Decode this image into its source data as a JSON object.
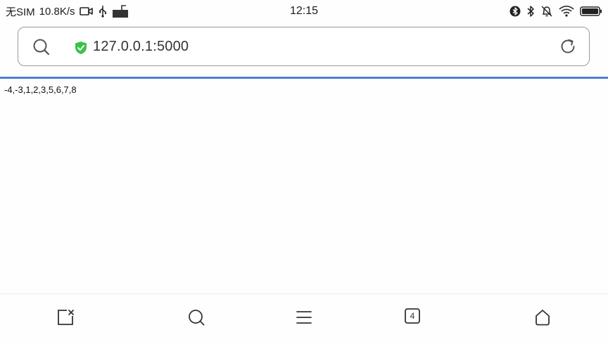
{
  "status_bar": {
    "carrier": "无SIM",
    "speed": "10.8K/s",
    "time": "12:15",
    "left_icons": [
      "video-call-icon",
      "usb-icon",
      "keyboard-icon"
    ],
    "right_icons": [
      "bluetooth-circle-icon",
      "bluetooth-icon",
      "alarm-off-icon",
      "wifi-icon",
      "battery-icon"
    ]
  },
  "address_bar": {
    "url": "127.0.0.1:5000",
    "secure_color": "#3cc24a"
  },
  "page": {
    "content_text": "-4,-3,1,2,3,5,6,7,8"
  },
  "bottom_toolbar": {
    "tabs_count": "4",
    "icons": [
      "close-page-icon",
      "search-icon",
      "menu-icon",
      "tabs-icon",
      "home-icon"
    ]
  },
  "colors": {
    "accent": "#4d7fd8",
    "background": "#fdfefd"
  }
}
